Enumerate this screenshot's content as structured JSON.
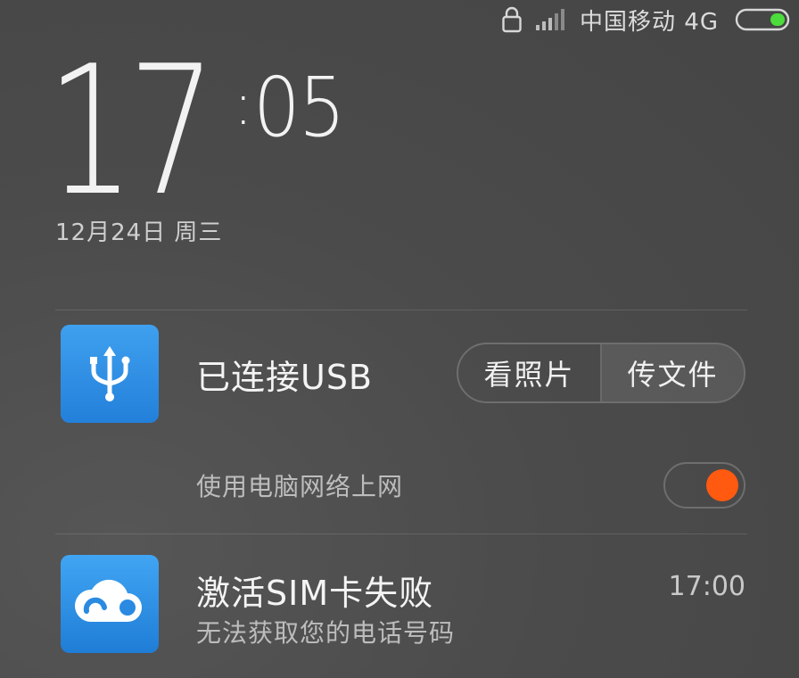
{
  "status_bar": {
    "carrier": "中国移动 4G",
    "icons": [
      "lock-icon",
      "signal-icon",
      "battery-icon"
    ],
    "battery_color": "#4cdc3c"
  },
  "lockscreen": {
    "hours": "17",
    "colon": ":",
    "minutes": "05",
    "date": "12月24日 周三"
  },
  "notifications": {
    "usb": {
      "icon": "usb-icon",
      "title": "已连接USB",
      "photos_button": "看照片",
      "files_button": "传文件",
      "network_label": "使用电脑网络上网",
      "network_toggle_on": true,
      "toggle_color": "#ff5a10"
    },
    "sim": {
      "icon": "cloud-icon",
      "title": "激活SIM卡失败",
      "subtitle": "无法获取您的电话号码",
      "time": "17:00"
    }
  }
}
